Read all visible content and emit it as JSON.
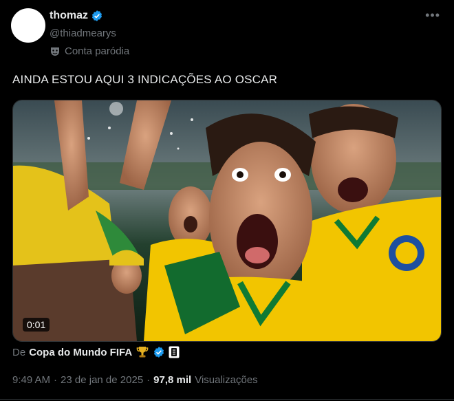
{
  "author": {
    "display_name": "thomaz",
    "handle": "@thiadmearys",
    "parody_label": "Conta paródia"
  },
  "tweet": {
    "text": "AINDA ESTOU AQUI 3 INDICAÇÕES AO OSCAR"
  },
  "media": {
    "duration": "0:01"
  },
  "source": {
    "prefix": "De",
    "name": "Copa do Mundo FIFA"
  },
  "meta": {
    "time": "9:49 AM",
    "separator1": "·",
    "date": "23 de jan de 2025",
    "separator2": "·",
    "views_count": "97,8 mil",
    "views_label": "Visualizações"
  },
  "colors": {
    "verified": "#1d9bf0",
    "background": "#000000",
    "muted_text": "#71767b",
    "jersey_yellow": "#f2c500",
    "jersey_green": "#0f7a34"
  },
  "icons": {
    "more": "more-icon",
    "verified": "verified-badge-icon",
    "parody": "parody-mask-icon",
    "trophy": "trophy-icon",
    "affiliate": "affiliate-badge-icon"
  }
}
